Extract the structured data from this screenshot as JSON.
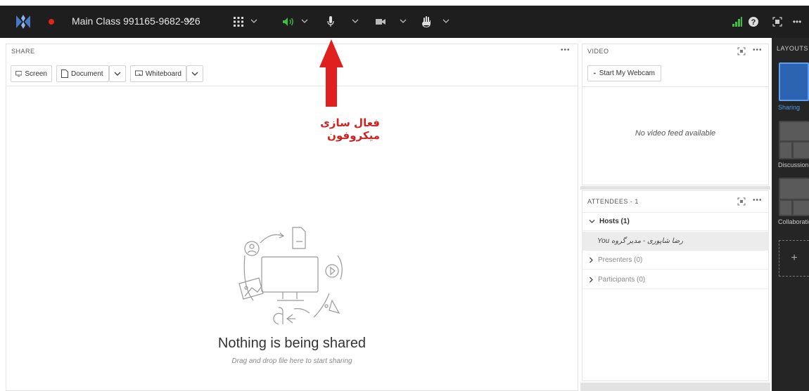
{
  "topbar": {
    "title": "Main Class 991165-9682-926",
    "colors": {
      "background": "#1e1e1e",
      "record": "#e1251b",
      "audio": "#3fbf3f",
      "signal": "#3fbf3f"
    },
    "icons": [
      "app-logo-icon",
      "record-dot-icon",
      "apps-grid-icon",
      "speaker-icon",
      "microphone-icon",
      "camera-icon",
      "raise-hand-icon",
      "signal-icon",
      "help-icon",
      "fullscreen-icon",
      "more-icon"
    ]
  },
  "share": {
    "label": "SHARE",
    "buttons": {
      "screen": "Screen",
      "document": "Document",
      "whiteboard": "Whiteboard"
    },
    "empty_title": "Nothing is being shared",
    "empty_subtitle": "Drag and drop file here to start sharing"
  },
  "annotation": {
    "text": "فعال سازی میکروفون",
    "color": "#d21f1f"
  },
  "video": {
    "label": "VIDEO",
    "webcam_button": "Start My Webcam",
    "no_feed": "No video feed available"
  },
  "attendees": {
    "label": "ATTENDEES - 1",
    "hosts": "Hosts (1)",
    "user": "You رضا شاپوری - مدیر گروه",
    "presenters": "Presenters (0)",
    "participants": "Participants (0)"
  },
  "layouts": {
    "title": "LAYOUTS",
    "items": [
      "Sharing",
      "Discussion",
      "Collaboration"
    ],
    "active": "Sharing",
    "accent": "#2c64b3"
  }
}
